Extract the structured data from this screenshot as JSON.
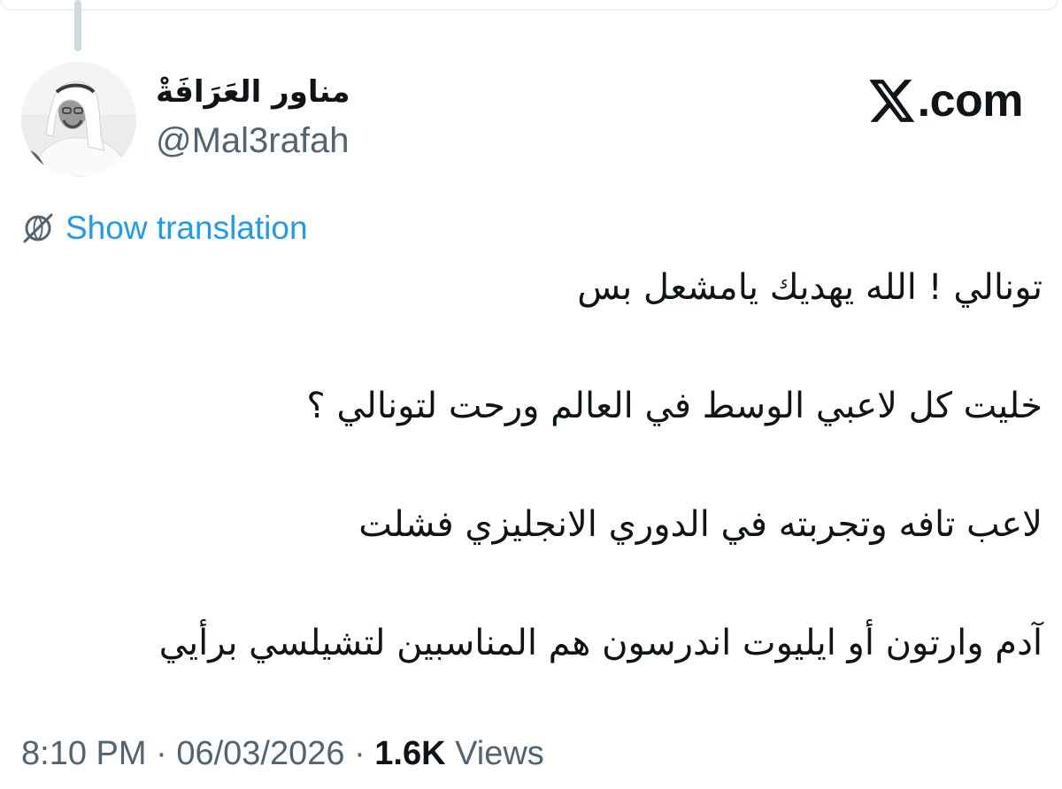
{
  "author": {
    "display_name": "مناور العَرَافَةْ",
    "handle": "@Mal3rafah"
  },
  "brand": {
    "domain": ".com",
    "icon": "x-logo-icon"
  },
  "translation": {
    "label": "Show translation",
    "icon": "translate-globe-icon"
  },
  "tweet": {
    "lines": [
      "تونالي ! الله يهديك يامشعل بس",
      "خليت كل لاعبي الوسط في العالم ورحت لتونالي ؟",
      "لاعب تافه وتجربته في الدوري الانجليزي فشلت",
      "آدم وارتون أو ايليوت اندرسون هم المناسبين لتشيلسي برأيي"
    ]
  },
  "meta": {
    "time": "8:10 PM",
    "separator": "·",
    "date": "06/03/2026",
    "views_count": "1.6K",
    "views_label": "Views"
  },
  "colors": {
    "accent": "#1d9bf0",
    "text_primary": "#0f1419",
    "text_secondary": "#536471",
    "thread_line": "#cfd9de"
  }
}
